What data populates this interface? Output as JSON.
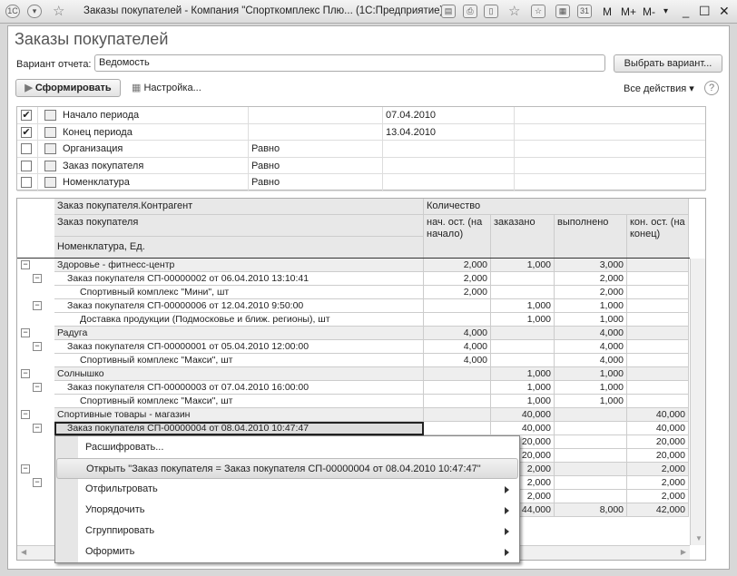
{
  "window": {
    "title": "Заказы покупателей - Компания \"Спорткомплекс Плю... (1С:Предприятие)",
    "m": "M",
    "mplus": "M+",
    "mminus": "M-"
  },
  "page_title": "Заказы покупателей",
  "variant": {
    "label": "Вариант отчета:",
    "value": "Ведомость",
    "choose_btn": "Выбрать вариант..."
  },
  "toolbar": {
    "generate": "Сформировать",
    "settings": "Настройка...",
    "all_actions": "Все действия",
    "help": "?"
  },
  "filters": [
    {
      "checked": true,
      "name": "Начало периода",
      "cond": "",
      "value": "07.04.2010"
    },
    {
      "checked": true,
      "name": "Конец периода",
      "cond": "",
      "value": "13.04.2010"
    },
    {
      "checked": false,
      "name": "Организация",
      "cond": "Равно",
      "value": ""
    },
    {
      "checked": false,
      "name": "Заказ покупателя",
      "cond": "Равно",
      "value": ""
    },
    {
      "checked": false,
      "name": "Номенклатура",
      "cond": "Равно",
      "value": ""
    }
  ],
  "report": {
    "headers": {
      "h1": "Заказ покупателя.Контрагент",
      "h2": "Заказ покупателя",
      "h3": "Номенклатура, Ед.",
      "qty": "Количество",
      "c1": "нач. ост. (на начало)",
      "c2": "заказано",
      "c3": "выполнено",
      "c4": "кон. ост. (на конец)"
    },
    "rows": [
      {
        "level": 0,
        "name": "Здоровье - фитнесс-центр",
        "v": [
          "2,000",
          "1,000",
          "3,000",
          ""
        ]
      },
      {
        "level": 1,
        "name": "Заказ покупателя СП-00000002 от 06.04.2010 13:10:41",
        "v": [
          "2,000",
          "",
          "2,000",
          ""
        ]
      },
      {
        "level": 2,
        "name": "Спортивный комплекс \"Мини\", шт",
        "v": [
          "2,000",
          "",
          "2,000",
          ""
        ]
      },
      {
        "level": 1,
        "name": "Заказ покупателя СП-00000006 от 12.04.2010 9:50:00",
        "v": [
          "",
          "1,000",
          "1,000",
          ""
        ]
      },
      {
        "level": 2,
        "name": "Доставка продукции (Подмосковье и ближ. регионы), шт",
        "v": [
          "",
          "1,000",
          "1,000",
          ""
        ]
      },
      {
        "level": 0,
        "name": "Радуга",
        "v": [
          "4,000",
          "",
          "4,000",
          ""
        ]
      },
      {
        "level": 1,
        "name": "Заказ покупателя СП-00000001 от 05.04.2010 12:00:00",
        "v": [
          "4,000",
          "",
          "4,000",
          ""
        ]
      },
      {
        "level": 2,
        "name": "Спортивный комплекс \"Макси\", шт",
        "v": [
          "4,000",
          "",
          "4,000",
          ""
        ]
      },
      {
        "level": 0,
        "name": "Солнышко",
        "v": [
          "",
          "1,000",
          "1,000",
          ""
        ]
      },
      {
        "level": 1,
        "name": "Заказ покупателя СП-00000003 от 07.04.2010 16:00:00",
        "v": [
          "",
          "1,000",
          "1,000",
          ""
        ]
      },
      {
        "level": 2,
        "name": "Спортивный комплекс \"Макси\", шт",
        "v": [
          "",
          "1,000",
          "1,000",
          ""
        ]
      },
      {
        "level": 0,
        "name": "Спортивные товары - магазин",
        "v": [
          "",
          "40,000",
          "",
          "40,000"
        ]
      },
      {
        "level": 1,
        "name": "Заказ покупателя СП-00000004 от 08.04.2010 10:47:47",
        "v": [
          "",
          "40,000",
          "",
          "40,000"
        ],
        "selected": true
      },
      {
        "level": 2,
        "name": "",
        "v": [
          "",
          "20,000",
          "",
          "20,000"
        ]
      },
      {
        "level": 2,
        "name": "",
        "v": [
          "",
          "20,000",
          "",
          "20,000"
        ]
      },
      {
        "level": 0,
        "name": "",
        "v": [
          "",
          "2,000",
          "",
          "2,000"
        ]
      },
      {
        "level": 1,
        "name": "",
        "v": [
          "",
          "2,000",
          "",
          "2,000"
        ]
      },
      {
        "level": 2,
        "name": "",
        "v": [
          "",
          "2,000",
          "",
          "2,000"
        ]
      },
      {
        "level": -1,
        "name": "",
        "v": [
          "",
          "44,000",
          "8,000",
          "42,000"
        ]
      }
    ]
  },
  "context_menu": [
    {
      "label": "Расшифровать...",
      "submenu": false
    },
    {
      "label": "Открыть \"Заказ покупателя = Заказ покупателя СП-00000004 от 08.04.2010 10:47:47\"",
      "submenu": false,
      "highlighted": true
    },
    {
      "label": "Отфильтровать",
      "submenu": true
    },
    {
      "label": "Упорядочить",
      "submenu": true
    },
    {
      "label": "Сгруппировать",
      "submenu": true
    },
    {
      "label": "Оформить",
      "submenu": true
    }
  ]
}
